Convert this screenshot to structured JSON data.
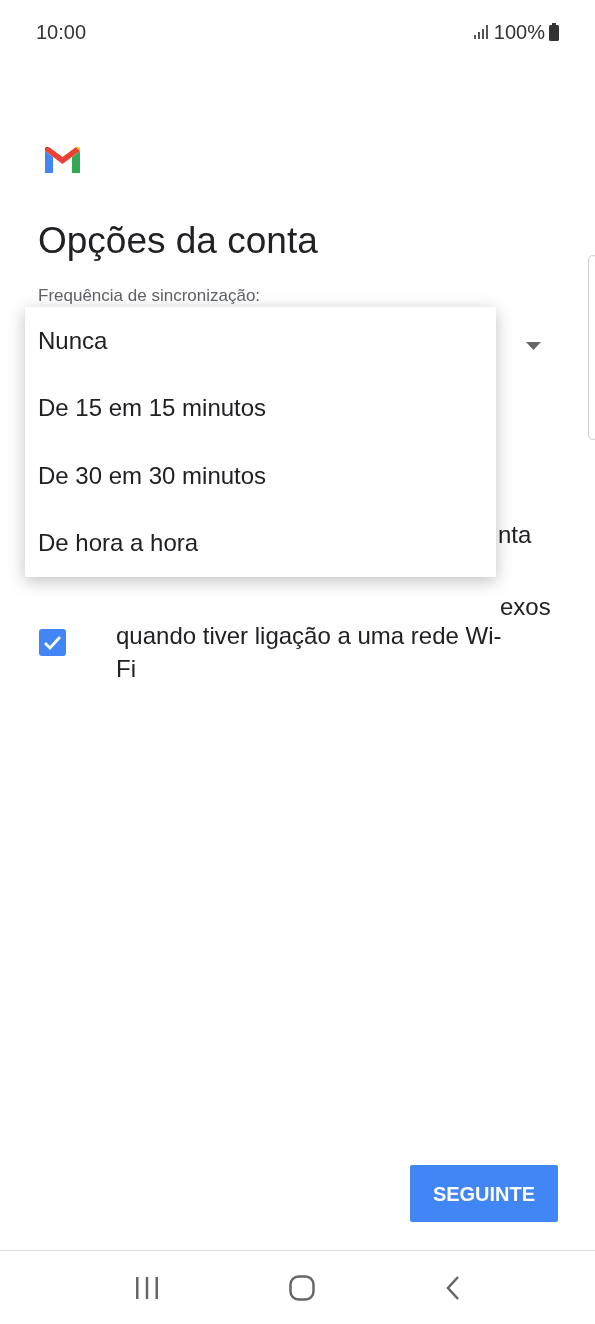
{
  "status_bar": {
    "time": "10:00",
    "battery": "100%"
  },
  "title": "Opções da conta",
  "sync_label": "Frequência de sincronização:",
  "hidden_fragments": [
    "nta",
    "exos"
  ],
  "attachments_option": {
    "label": "quando tiver ligação a uma rede Wi-Fi",
    "checked": true
  },
  "dropdown_menu": {
    "items": [
      "Nunca",
      "De 15 em 15 minutos",
      "De 30 em 30 minutos",
      "De hora a hora"
    ]
  },
  "next_button": "SEGUINTE"
}
